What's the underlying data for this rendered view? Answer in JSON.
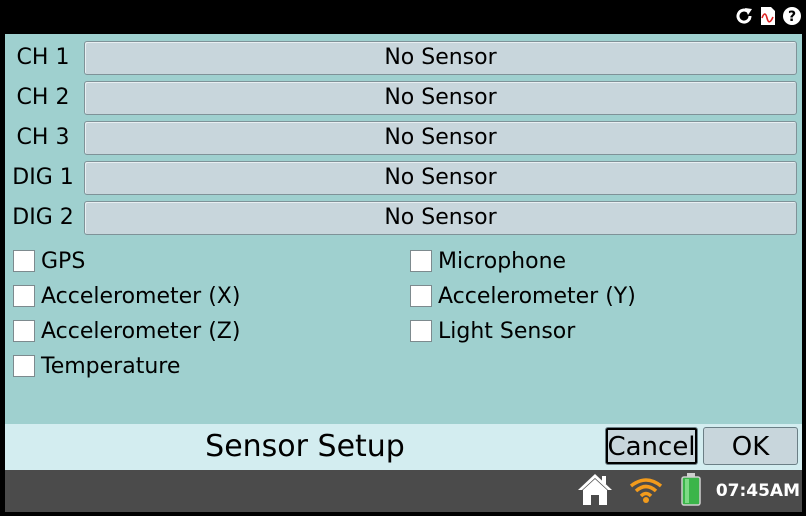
{
  "channels": [
    {
      "label": "CH 1",
      "value": "No Sensor"
    },
    {
      "label": "CH 2",
      "value": "No Sensor"
    },
    {
      "label": "CH 3",
      "value": "No Sensor"
    },
    {
      "label": "DIG 1",
      "value": "No Sensor"
    },
    {
      "label": "DIG 2",
      "value": "No Sensor"
    }
  ],
  "checkboxes": [
    {
      "label": "GPS",
      "checked": false
    },
    {
      "label": "Microphone",
      "checked": false
    },
    {
      "label": "Accelerometer (X)",
      "checked": false
    },
    {
      "label": "Accelerometer (Y)",
      "checked": false
    },
    {
      "label": "Accelerometer (Z)",
      "checked": false
    },
    {
      "label": "Light Sensor",
      "checked": false
    },
    {
      "label": "Temperature",
      "checked": false
    }
  ],
  "footer": {
    "title": "Sensor Setup",
    "cancel_label": "Cancel",
    "ok_label": "OK"
  },
  "status": {
    "time": "07:45AM"
  },
  "top_icons": [
    "refresh-icon",
    "graph-file-icon",
    "help-icon"
  ],
  "colors": {
    "panel": "#9fd0cf",
    "footer": "#d3edf0",
    "button": "#c8d6dc",
    "statusbar": "#4b4b4b",
    "battery": "#3bb54a"
  }
}
